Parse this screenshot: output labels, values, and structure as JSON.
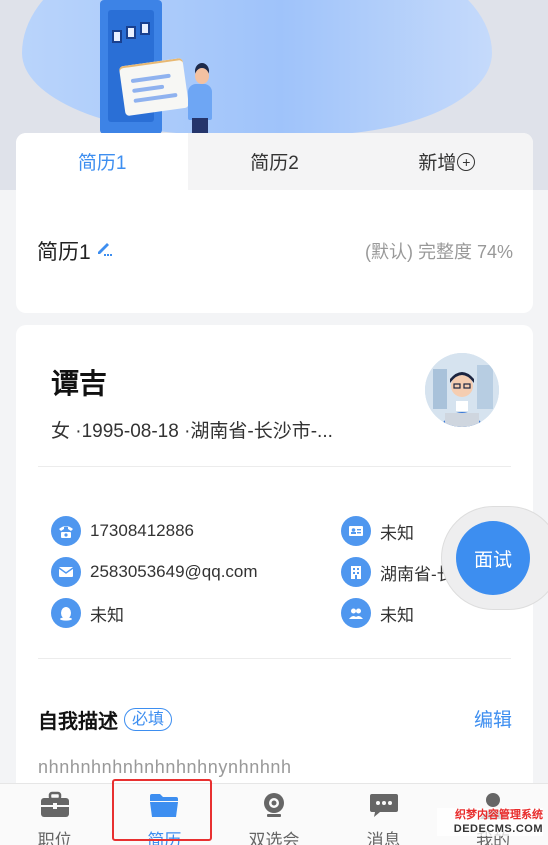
{
  "resume_tabs": [
    "简历1",
    "简历2",
    "新增"
  ],
  "add_icon": "plus-circle-icon",
  "resume": {
    "title": "简历1",
    "meta": "(默认) 完整度 74%"
  },
  "profile": {
    "name": "谭吉",
    "basic_info": "女 ·1995-08-18 ·湖南省-长沙市-...",
    "contacts": {
      "phone": "17308412886",
      "id_card": "未知",
      "email": "2583053649@qq.com",
      "hometown": "湖南省-长",
      "qq": "未知",
      "marital": "未知"
    }
  },
  "self_description": {
    "title": "自我描述",
    "required_label": "必填",
    "edit_label": "编辑",
    "content": "nhnhnhnhnhnhnhnhnynhnhnh"
  },
  "float_button": "面试",
  "bottom_nav": [
    {
      "label": "职位",
      "icon": "briefcase-icon"
    },
    {
      "label": "简历",
      "icon": "folder-icon"
    },
    {
      "label": "双选会",
      "icon": "webcam-icon"
    },
    {
      "label": "消息",
      "icon": "chat-bubble-icon"
    },
    {
      "label": "我的",
      "icon": "user-icon"
    }
  ],
  "active_nav": "简历",
  "watermark": {
    "line1": "织梦内容管理系统",
    "line2": "DEDECMS.COM"
  },
  "colors": {
    "accent": "#3d8ef0",
    "highlight_border": "#e83030"
  }
}
